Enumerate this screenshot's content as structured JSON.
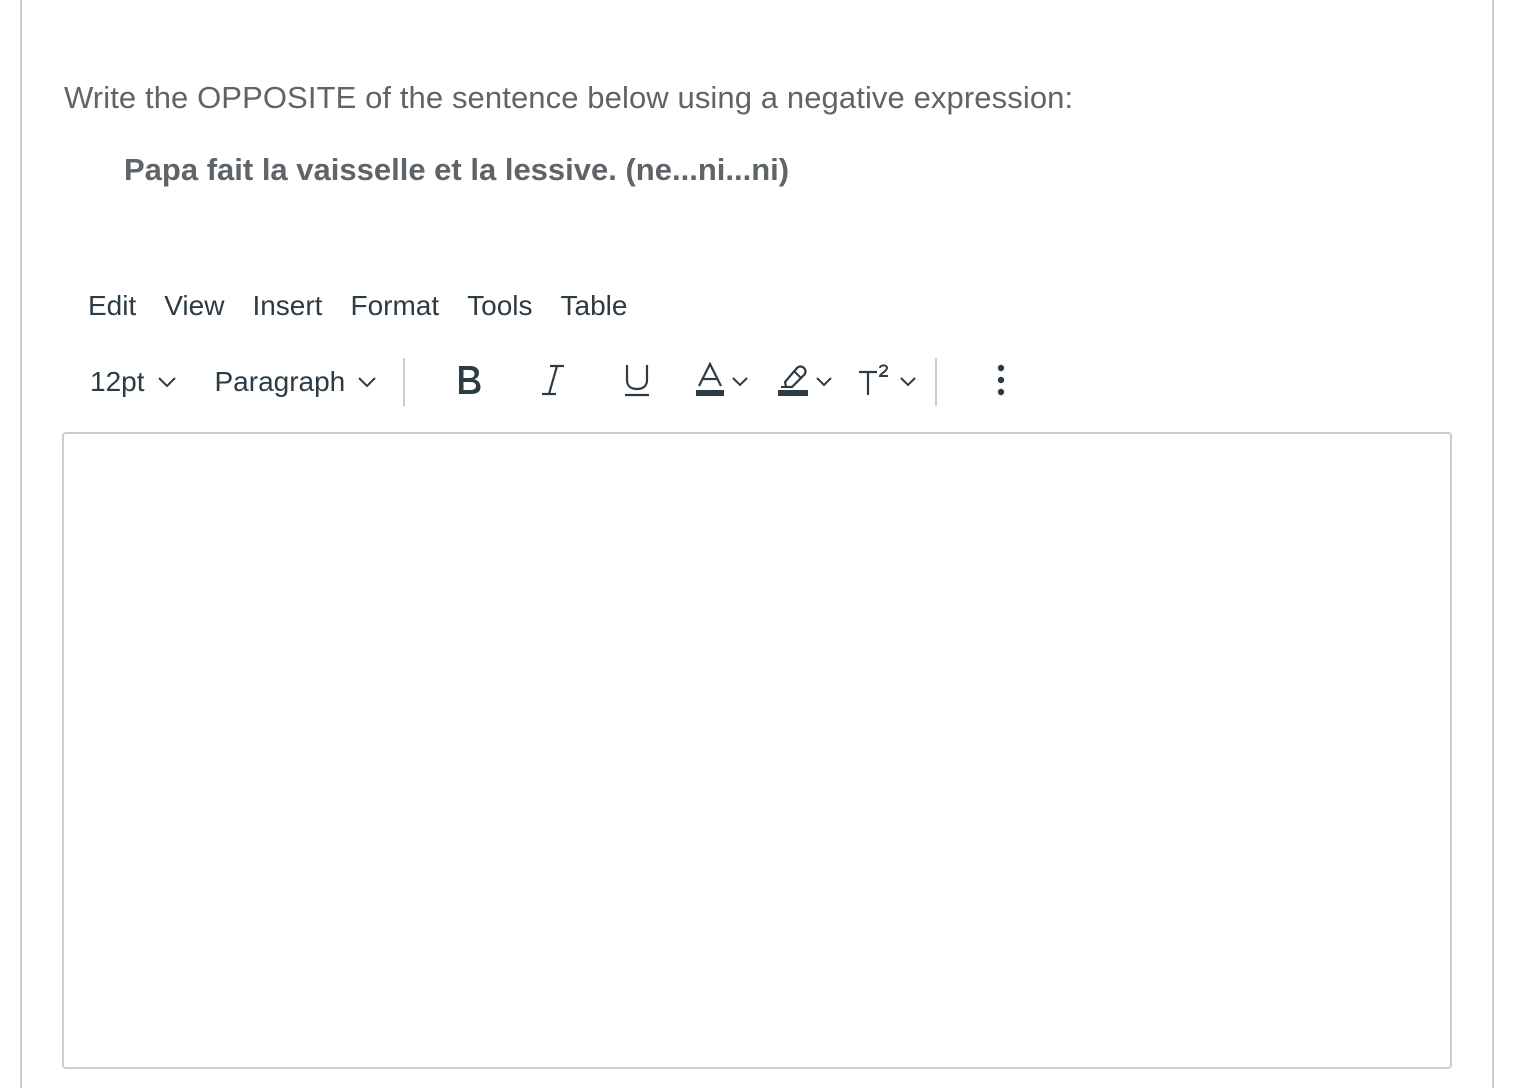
{
  "question": {
    "prompt": "Write the OPPOSITE of the sentence below using a negative expression:",
    "sentence": "Papa fait la vaisselle et la lessive. (ne...ni...ni)"
  },
  "editor": {
    "menubar": [
      "Edit",
      "View",
      "Insert",
      "Format",
      "Tools",
      "Table"
    ],
    "toolbar": {
      "font_size": "12pt",
      "block_format": "Paragraph",
      "buttons": [
        "bold-icon",
        "italic-icon",
        "underline-icon",
        "text-color-icon",
        "highlight-color-icon",
        "superscript-icon",
        "more-vertical-icon"
      ]
    },
    "content": ""
  },
  "colors": {
    "text_muted": "#5f6468",
    "text_primary": "#2d3b45",
    "border": "#c7cdd1"
  }
}
